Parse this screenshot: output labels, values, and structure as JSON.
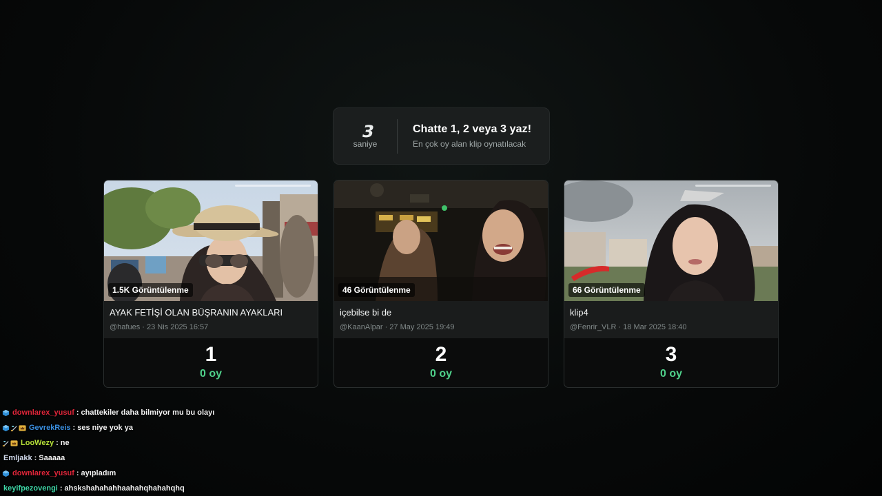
{
  "countdown": {
    "value": "3",
    "unit": "saniye",
    "title": "Chatte 1, 2 veya 3 yaz!",
    "subtitle": "En çok oy alan klip oynatılacak"
  },
  "clips": [
    {
      "views": "1.5K Görüntülenme",
      "title": "AYAK FETİŞİ OLAN BÜŞRANIN AYAKLARI",
      "info": "@hafues · 23 Nis 2025 16:57",
      "number": "1",
      "votes": "0 oy"
    },
    {
      "views": "46 Görüntülenme",
      "title": "içebilse bi de",
      "info": "@KaanAlpar · 27 May 2025 19:49",
      "number": "2",
      "votes": "0 oy"
    },
    {
      "views": "66 Görüntülenme",
      "title": "klip4",
      "info": "@Fenrir_VLR · 18 Mar 2025 18:40",
      "number": "3",
      "votes": "0 oy"
    }
  ],
  "chat": [
    {
      "badges": [
        "cube"
      ],
      "user": "downlarex_yusuf",
      "color": "#e0263a",
      "message": "chattekiler daha bilmiyor mu bu olayı"
    },
    {
      "badges": [
        "cube",
        "sword",
        "crown"
      ],
      "user": "GevrekReis",
      "color": "#3a8fe0",
      "message": "ses niye yok ya"
    },
    {
      "badges": [
        "sword",
        "crown"
      ],
      "user": "LooWezy",
      "color": "#b7e23a",
      "message": "ne"
    },
    {
      "badges": [],
      "user": "Emljakk",
      "color": "#cfd8ea",
      "message": "Saaaaa"
    },
    {
      "badges": [
        "cube"
      ],
      "user": "downlarex_yusuf",
      "color": "#e0263a",
      "message": "ayıpladım"
    },
    {
      "badges": [],
      "user": "keyifpezovengi",
      "color": "#3ed6a6",
      "message": "ahskshahahahhaahahqhahahqhq"
    }
  ],
  "colors": {
    "vote_green": "#4fd08a",
    "banner_bg": "#1b1e1e",
    "card_meta_bg": "#1a1c1c"
  }
}
